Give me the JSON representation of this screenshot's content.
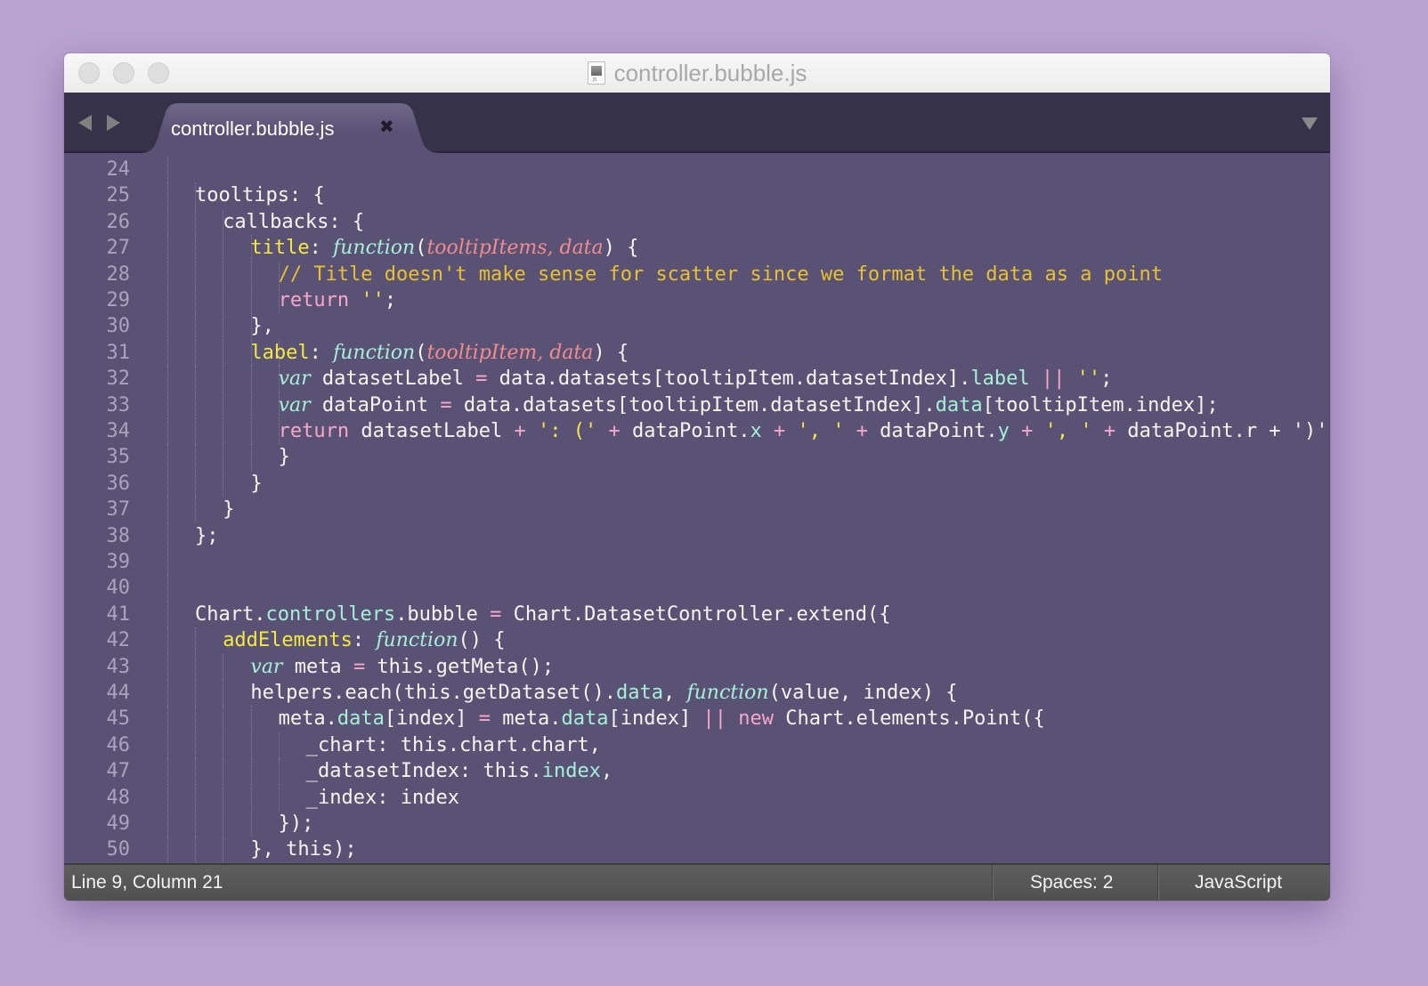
{
  "window": {
    "title": "controller.bubble.js",
    "title_icon": "javascript-file-icon"
  },
  "tabbar": {
    "tabs": [
      {
        "label": "controller.bubble.js",
        "active": true,
        "close_glyph": "✖"
      }
    ],
    "nav_back": "◀",
    "nav_forward": "▶",
    "menu_glyph": "▼"
  },
  "editor": {
    "theme_colors": {
      "background": "#5a5275",
      "text": "#f5f5f0",
      "key": "#f5e842",
      "function": "#a6f0d8",
      "param": "#f28c8c",
      "comment": "#e8c12e",
      "keyword": "#f7a8c8"
    },
    "lines": [
      {
        "n": "24",
        "indent": 2,
        "tokens": []
      },
      {
        "n": "25",
        "indent": 2,
        "tokens": [
          [
            "t",
            "tooltips: {"
          ]
        ]
      },
      {
        "n": "26",
        "indent": 3,
        "tokens": [
          [
            "t",
            "callbacks: {"
          ]
        ]
      },
      {
        "n": "27",
        "indent": 4,
        "tokens": [
          [
            "k",
            "title"
          ],
          [
            "t",
            ": "
          ],
          [
            "fn",
            "function"
          ],
          [
            "t",
            "("
          ],
          [
            "pm",
            "tooltipItems, data"
          ],
          [
            "t",
            ") {"
          ]
        ]
      },
      {
        "n": "28",
        "indent": 5,
        "tokens": [
          [
            "cm",
            "// Title doesn't make sense for scatter since we format the data as a point"
          ]
        ]
      },
      {
        "n": "29",
        "indent": 5,
        "tokens": [
          [
            "kw",
            "return"
          ],
          [
            "t",
            " "
          ],
          [
            "st",
            "''"
          ],
          [
            "t",
            ";"
          ]
        ]
      },
      {
        "n": "30",
        "indent": 4,
        "tokens": [
          [
            "t",
            "},"
          ]
        ]
      },
      {
        "n": "31",
        "indent": 4,
        "tokens": [
          [
            "k",
            "label"
          ],
          [
            "t",
            ": "
          ],
          [
            "fn",
            "function"
          ],
          [
            "t",
            "("
          ],
          [
            "pm",
            "tooltipItem, data"
          ],
          [
            "t",
            ") {"
          ]
        ]
      },
      {
        "n": "32",
        "indent": 5,
        "tokens": [
          [
            "fn",
            "var"
          ],
          [
            "t",
            " datasetLabel "
          ],
          [
            "op",
            "="
          ],
          [
            "t",
            " data.datasets[tooltipItem.datasetIndex]."
          ],
          [
            "pr",
            "label"
          ],
          [
            "t",
            " "
          ],
          [
            "op",
            "||"
          ],
          [
            "t",
            " "
          ],
          [
            "st",
            "''"
          ],
          [
            "t",
            ";"
          ]
        ]
      },
      {
        "n": "33",
        "indent": 5,
        "tokens": [
          [
            "fn",
            "var"
          ],
          [
            "t",
            " dataPoint "
          ],
          [
            "op",
            "="
          ],
          [
            "t",
            " data.datasets[tooltipItem.datasetIndex]."
          ],
          [
            "pr",
            "data"
          ],
          [
            "t",
            "[tooltipItem.index];"
          ]
        ]
      },
      {
        "n": "34",
        "indent": 5,
        "tokens": [
          [
            "kw",
            "return"
          ],
          [
            "t",
            " datasetLabel "
          ],
          [
            "op",
            "+"
          ],
          [
            "t",
            " "
          ],
          [
            "st",
            "': ('"
          ],
          [
            "t",
            " "
          ],
          [
            "op",
            "+"
          ],
          [
            "t",
            " dataPoint."
          ],
          [
            "pr",
            "x"
          ],
          [
            "t",
            " "
          ],
          [
            "op",
            "+"
          ],
          [
            "t",
            " "
          ],
          [
            "st",
            "', '"
          ],
          [
            "t",
            " "
          ],
          [
            "op",
            "+"
          ],
          [
            "t",
            " dataPoint."
          ],
          [
            "pr",
            "y"
          ],
          [
            "t",
            " "
          ],
          [
            "op",
            "+"
          ],
          [
            "t",
            " "
          ],
          [
            "st",
            "', '"
          ],
          [
            "t",
            " "
          ],
          [
            "op",
            "+"
          ],
          [
            "t",
            " dataPoint.r + ')';"
          ]
        ]
      },
      {
        "n": "35",
        "indent": 5,
        "tokens": [
          [
            "t",
            "}"
          ]
        ]
      },
      {
        "n": "36",
        "indent": 4,
        "tokens": [
          [
            "t",
            "}"
          ]
        ]
      },
      {
        "n": "37",
        "indent": 3,
        "tokens": [
          [
            "t",
            "}"
          ]
        ]
      },
      {
        "n": "38",
        "indent": 2,
        "tokens": [
          [
            "t",
            "};"
          ]
        ]
      },
      {
        "n": "39",
        "indent": 0,
        "tokens": []
      },
      {
        "n": "40",
        "indent": 0,
        "tokens": []
      },
      {
        "n": "41",
        "indent": 2,
        "tokens": [
          [
            "t",
            "Chart."
          ],
          [
            "pr",
            "controllers"
          ],
          [
            "t",
            ".bubble "
          ],
          [
            "op",
            "="
          ],
          [
            "t",
            " Chart.DatasetController.extend({"
          ]
        ]
      },
      {
        "n": "42",
        "indent": 3,
        "tokens": [
          [
            "k",
            "addElements"
          ],
          [
            "t",
            ": "
          ],
          [
            "fn",
            "function"
          ],
          [
            "t",
            "() {"
          ]
        ]
      },
      {
        "n": "43",
        "indent": 4,
        "tokens": [
          [
            "fn",
            "var"
          ],
          [
            "t",
            " meta "
          ],
          [
            "op",
            "="
          ],
          [
            "t",
            " this.getMeta();"
          ]
        ]
      },
      {
        "n": "44",
        "indent": 4,
        "tokens": [
          [
            "t",
            "helpers.each(this.getDataset()."
          ],
          [
            "pr",
            "data"
          ],
          [
            "t",
            ", "
          ],
          [
            "fn",
            "function"
          ],
          [
            "t",
            "(value, index) {"
          ]
        ]
      },
      {
        "n": "45",
        "indent": 5,
        "tokens": [
          [
            "t",
            "meta."
          ],
          [
            "pr",
            "data"
          ],
          [
            "t",
            "[index] "
          ],
          [
            "op",
            "="
          ],
          [
            "t",
            " meta."
          ],
          [
            "pr",
            "data"
          ],
          [
            "t",
            "[index] "
          ],
          [
            "op",
            "||"
          ],
          [
            "t",
            " "
          ],
          [
            "kw",
            "new"
          ],
          [
            "t",
            " Chart.elements.Point({"
          ]
        ]
      },
      {
        "n": "46",
        "indent": 6,
        "tokens": [
          [
            "t",
            "_chart: this.chart.chart,"
          ]
        ]
      },
      {
        "n": "47",
        "indent": 6,
        "tokens": [
          [
            "t",
            "_datasetIndex: this."
          ],
          [
            "pr",
            "index"
          ],
          [
            "t",
            ","
          ]
        ]
      },
      {
        "n": "48",
        "indent": 6,
        "tokens": [
          [
            "t",
            "_index: index"
          ]
        ]
      },
      {
        "n": "49",
        "indent": 5,
        "tokens": [
          [
            "t",
            "});"
          ]
        ]
      },
      {
        "n": "50",
        "indent": 4,
        "tokens": [
          [
            "t",
            "}, this);"
          ]
        ]
      }
    ],
    "guides_per_line": [
      1,
      2,
      3,
      4,
      5,
      5,
      4,
      5,
      5,
      5,
      5,
      4,
      3,
      2,
      1,
      1,
      1,
      1,
      2,
      3,
      3,
      4,
      5,
      5,
      5,
      4,
      3
    ]
  },
  "statusbar": {
    "position": "Line 9, Column 21",
    "indentation": "Spaces: 2",
    "syntax": "JavaScript"
  }
}
